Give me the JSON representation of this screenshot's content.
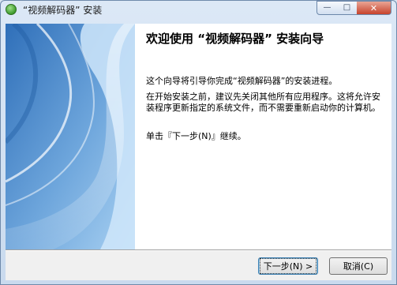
{
  "window": {
    "title": "“视频解码器” 安装"
  },
  "caption": {
    "minimize": "—",
    "maximize": "□",
    "close": "✕"
  },
  "wizard": {
    "heading": "欢迎使用 “视频解码器” 安装向导",
    "paragraph1": "这个向导将引导你完成“视频解码器”的安装进程。",
    "paragraph2": "在开始安装之前，建议先关闭其他所有应用程序。这将允许安装程序更新指定的系统文件，而不需要重新启动你的计算机。",
    "paragraph3": "单击『下一步(N)』继续。"
  },
  "buttons": {
    "next": "下一步(N) >",
    "cancel": "取消(C)"
  },
  "colors": {
    "accent": "#3c7fb1",
    "banner_dark": "#2f6fb9",
    "banner_light": "#a9d1f2"
  }
}
